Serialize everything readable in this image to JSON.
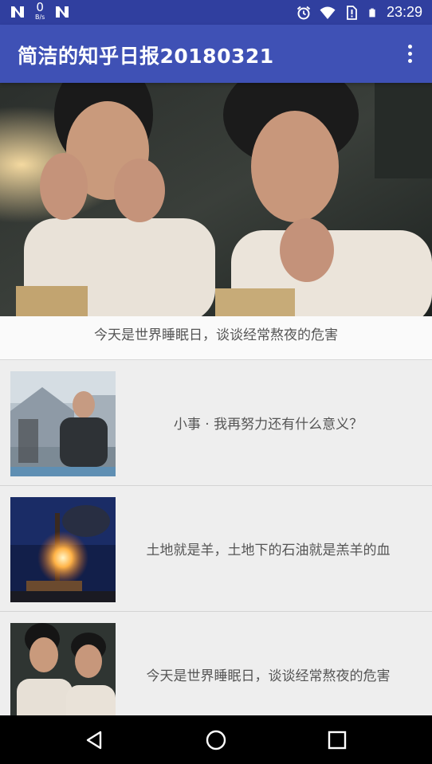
{
  "status_bar": {
    "speed_value": "0",
    "speed_unit": "B/s",
    "time": "23:29",
    "icons": [
      "n-logo-icon",
      "n-logo-icon",
      "alarm-icon",
      "wifi-icon",
      "no-sim-icon",
      "battery-icon"
    ]
  },
  "app_bar": {
    "title": "简洁的知乎日报20180321",
    "overflow_icon": "more-vert-icon"
  },
  "banner": {
    "caption": "今天是世界睡眠日，谈谈经常熬夜的危害"
  },
  "stories": [
    {
      "title": "小事 · 我再努力还有什么意义？"
    },
    {
      "title": "土地就是羊，土地下的石油就是羔羊的血"
    },
    {
      "title": "今天是世界睡眠日，谈谈经常熬夜的危害"
    }
  ],
  "nav_bar": {
    "icons": [
      "back-icon",
      "home-icon",
      "recents-icon"
    ]
  },
  "colors": {
    "status_bar": "#303f9f",
    "app_bar": "#3f51b5",
    "list_background": "#eeeeee"
  }
}
